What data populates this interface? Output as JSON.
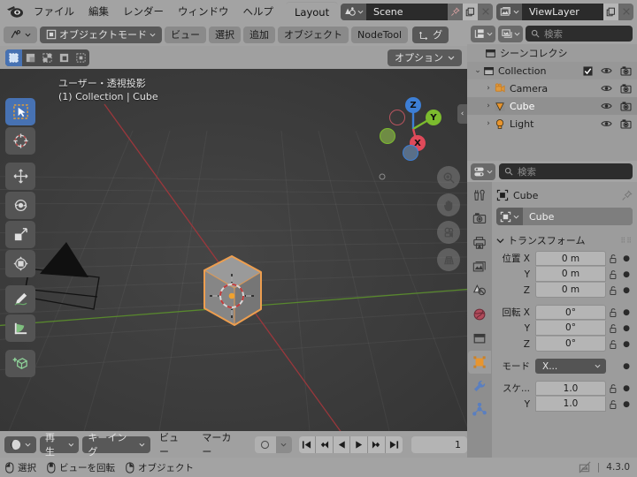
{
  "app": {
    "version_label": "4.3.0"
  },
  "topbar": {
    "menus": [
      "ファイル",
      "編集",
      "レンダー",
      "ウィンドウ",
      "ヘルプ"
    ],
    "workspace_tabs": [
      {
        "label": "Layout",
        "active": true
      }
    ],
    "scene": {
      "name": "Scene",
      "pin_icon": "pin-icon",
      "new_icon": "copy-icon",
      "unlink_icon": "x-icon"
    },
    "view_layer": {
      "name": "ViewLayer",
      "new_icon": "copy-icon",
      "unlink_icon": "x-icon"
    }
  },
  "viewport": {
    "header": {
      "mode": "オブジェクトモード",
      "menus": [
        "ビュー",
        "選択",
        "追加",
        "オブジェクト",
        "NodeTool"
      ],
      "orientation": "グ"
    },
    "header2": {
      "options_label": "オプション"
    },
    "overlay": {
      "view_name": "ユーザー・透視投影",
      "collection_object": "(1) Collection | Cube"
    },
    "gizmo": {
      "x": "X",
      "y": "Y",
      "z": "Z"
    },
    "tools": [
      "select-box-icon",
      "cursor-icon",
      "move-icon",
      "rotate-icon",
      "scale-icon",
      "transform-icon",
      "annotate-icon",
      "measure-icon",
      "add-cube-icon"
    ],
    "nav_tools": [
      "zoom-icon",
      "pan-hand-icon",
      "camera-view-icon",
      "ortho-persp-icon"
    ]
  },
  "timeline": {
    "editor_icon": "timeline-icon",
    "playback_label": "再生",
    "keying_label": "キーイング",
    "menus": [
      "ビュー",
      "マーカー"
    ],
    "marker_icon": "circle-icon",
    "playback_buttons": [
      "jump-start-icon",
      "prev-keyframe-icon",
      "play-reverse-icon",
      "play-icon",
      "next-keyframe-icon",
      "jump-end-icon"
    ],
    "current_frame": "1"
  },
  "outliner": {
    "display_mode_icon": "outliner-icon",
    "filter_icon": "filter-icon",
    "search_placeholder": "検索",
    "rows": [
      {
        "label": "シーンコレクシ",
        "icon": "collection-icon",
        "depth": 0,
        "expander": "",
        "checkbox": false,
        "eye": false,
        "camera": false,
        "selected": false
      },
      {
        "label": "Collection",
        "icon": "collection-icon",
        "depth": 1,
        "expander": "v",
        "checkbox": true,
        "eye": true,
        "camera": true,
        "selected": false
      },
      {
        "label": "Camera",
        "icon": "camera-object-icon",
        "depth": 2,
        "expander": ">",
        "checkbox": false,
        "eye": true,
        "camera": true,
        "selected": false
      },
      {
        "label": "Cube",
        "icon": "mesh-object-icon",
        "depth": 2,
        "expander": ">",
        "checkbox": false,
        "eye": true,
        "camera": true,
        "selected": true
      },
      {
        "label": "Light",
        "icon": "light-object-icon",
        "depth": 2,
        "expander": ">",
        "checkbox": false,
        "eye": true,
        "camera": true,
        "selected": false
      }
    ]
  },
  "properties": {
    "editor_icon": "properties-icon",
    "search_placeholder": "検索",
    "breadcrumb": "Cube",
    "pin_icon": "pin-icon",
    "object_name": "Cube",
    "tabs": [
      {
        "name": "tool-tab",
        "icon": "tool-icon",
        "active": false
      },
      {
        "name": "render-tab",
        "icon": "camera-back-icon",
        "active": false
      },
      {
        "name": "output-tab",
        "icon": "printer-icon",
        "active": false
      },
      {
        "name": "view-layer-tab",
        "icon": "images-icon",
        "active": false
      },
      {
        "name": "scene-tab",
        "icon": "cone-sphere-icon",
        "active": false
      },
      {
        "name": "world-tab",
        "icon": "world-icon",
        "active": false
      },
      {
        "name": "collection-tab",
        "icon": "collection-icon",
        "active": false
      },
      {
        "name": "object-tab",
        "icon": "object-square-icon",
        "active": true
      },
      {
        "name": "modifiers-tab",
        "icon": "wrench-icon",
        "active": false
      },
      {
        "name": "particles-tab",
        "icon": "particles-icon",
        "active": false
      }
    ],
    "transform_panel": {
      "title": "トランスフォーム",
      "location": {
        "label": "位置",
        "axes": [
          "X",
          "Y",
          "Z"
        ],
        "values": [
          "0 m",
          "0 m",
          "0 m"
        ]
      },
      "rotation": {
        "label": "回転",
        "axes": [
          "X",
          "Y",
          "Z"
        ],
        "values": [
          "0°",
          "0°",
          "0°"
        ]
      },
      "mode": {
        "label": "モード",
        "value": "X..."
      },
      "scale": {
        "label": "スケ...",
        "axes": [
          "",
          "Y"
        ],
        "values": [
          "1.0",
          "1.0"
        ]
      }
    }
  },
  "statusbar": {
    "items": [
      {
        "icon": "mouse-left-icon",
        "label": "選択"
      },
      {
        "icon": "mouse-middle-icon",
        "label": "ビューを回転"
      },
      {
        "icon": "mouse-right-icon",
        "label": "オブジェクト"
      }
    ],
    "scene_stats_icon": "no-scene-stats-icon",
    "separator": "|",
    "version": "4.3.0"
  },
  "colors": {
    "accent_blue": "#4772b3",
    "selection_orange": "#ed9e4f",
    "axis_x_red": "#a0373c",
    "axis_y_green": "#5a8c2d"
  }
}
